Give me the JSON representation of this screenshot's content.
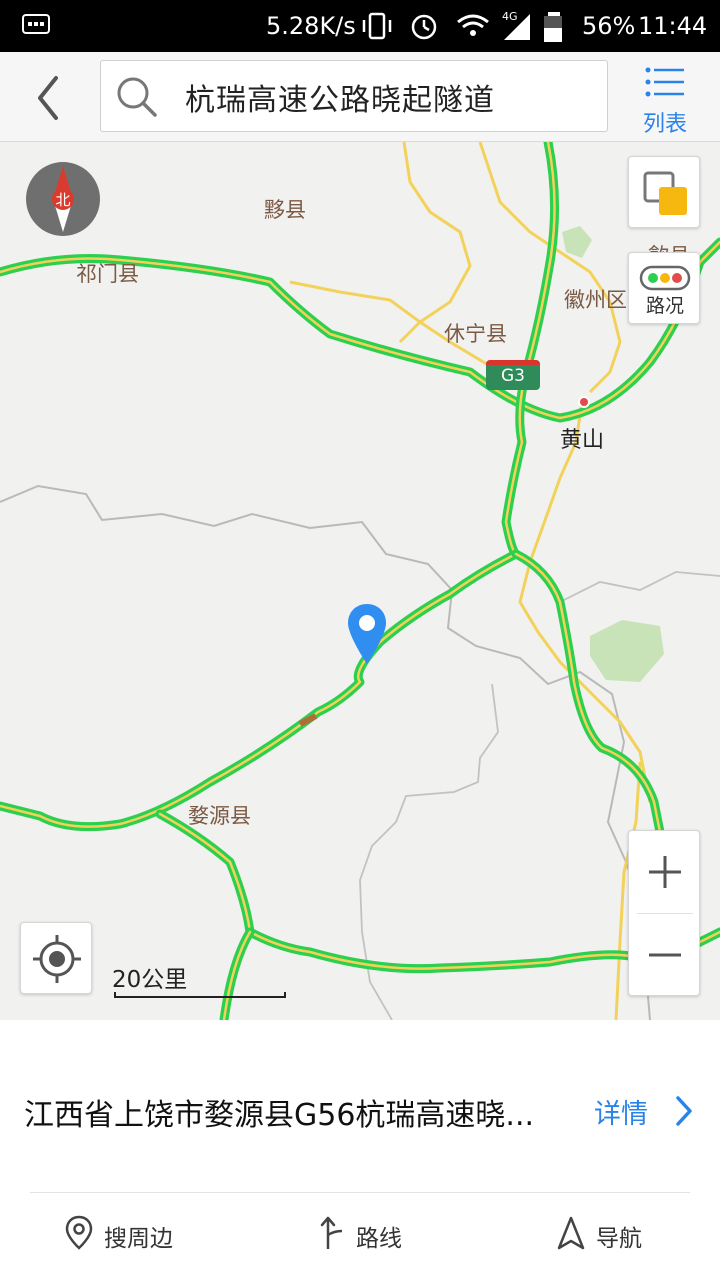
{
  "status_bar": {
    "speed": "5.28K/s",
    "network": "4G",
    "battery": "56%",
    "time": "11:44"
  },
  "header": {
    "back_icon": "chevron-left-icon",
    "search_icon": "search-icon",
    "search_value": "杭瑞高速公路晓起隧道",
    "list_label": "列表",
    "list_icon": "list-icon"
  },
  "map": {
    "compass_label": "北",
    "traffic_label": "路况",
    "highway_shield": "G3",
    "scale_label": "20公里",
    "places": {
      "yixian": "黟县",
      "qimen": "祁门县",
      "xiuning": "休宁县",
      "huizhou": "徽州区",
      "huangshan": "黄山",
      "wuyuan": "婺源县",
      "she_partial": "歙县"
    },
    "colors": {
      "highway": "#2dcf4f",
      "road_yellow": "#f2d25a",
      "border": "#b9b9b9",
      "pin": "#2f8ef0",
      "accent": "#2a83e8"
    }
  },
  "info": {
    "address": "江西省上饶市婺源县G56杭瑞高速晓...",
    "detail_label": "详情"
  },
  "actions": {
    "nearby": "搜周边",
    "route": "路线",
    "navigate": "导航"
  }
}
